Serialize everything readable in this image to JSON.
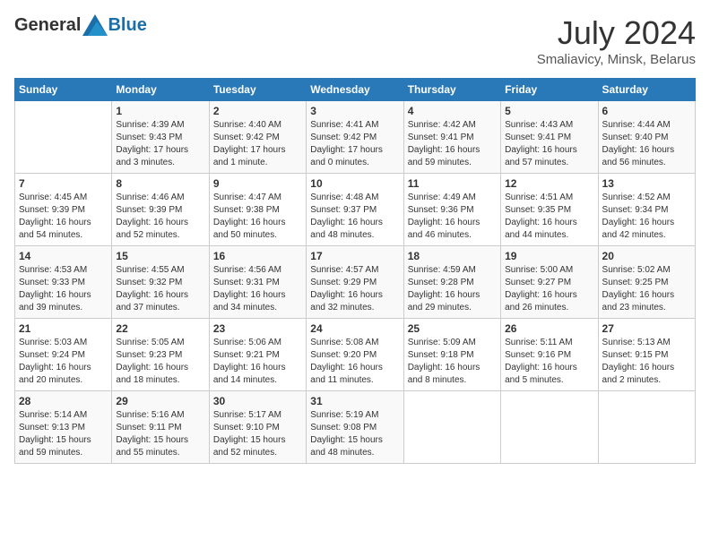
{
  "logo": {
    "general": "General",
    "blue": "Blue"
  },
  "header": {
    "month_year": "July 2024",
    "location": "Smaliavicy, Minsk, Belarus"
  },
  "days_of_week": [
    "Sunday",
    "Monday",
    "Tuesday",
    "Wednesday",
    "Thursday",
    "Friday",
    "Saturday"
  ],
  "weeks": [
    [
      {
        "day": "",
        "info": ""
      },
      {
        "day": "1",
        "info": "Sunrise: 4:39 AM\nSunset: 9:43 PM\nDaylight: 17 hours\nand 3 minutes."
      },
      {
        "day": "2",
        "info": "Sunrise: 4:40 AM\nSunset: 9:42 PM\nDaylight: 17 hours\nand 1 minute."
      },
      {
        "day": "3",
        "info": "Sunrise: 4:41 AM\nSunset: 9:42 PM\nDaylight: 17 hours\nand 0 minutes."
      },
      {
        "day": "4",
        "info": "Sunrise: 4:42 AM\nSunset: 9:41 PM\nDaylight: 16 hours\nand 59 minutes."
      },
      {
        "day": "5",
        "info": "Sunrise: 4:43 AM\nSunset: 9:41 PM\nDaylight: 16 hours\nand 57 minutes."
      },
      {
        "day": "6",
        "info": "Sunrise: 4:44 AM\nSunset: 9:40 PM\nDaylight: 16 hours\nand 56 minutes."
      }
    ],
    [
      {
        "day": "7",
        "info": "Sunrise: 4:45 AM\nSunset: 9:39 PM\nDaylight: 16 hours\nand 54 minutes."
      },
      {
        "day": "8",
        "info": "Sunrise: 4:46 AM\nSunset: 9:39 PM\nDaylight: 16 hours\nand 52 minutes."
      },
      {
        "day": "9",
        "info": "Sunrise: 4:47 AM\nSunset: 9:38 PM\nDaylight: 16 hours\nand 50 minutes."
      },
      {
        "day": "10",
        "info": "Sunrise: 4:48 AM\nSunset: 9:37 PM\nDaylight: 16 hours\nand 48 minutes."
      },
      {
        "day": "11",
        "info": "Sunrise: 4:49 AM\nSunset: 9:36 PM\nDaylight: 16 hours\nand 46 minutes."
      },
      {
        "day": "12",
        "info": "Sunrise: 4:51 AM\nSunset: 9:35 PM\nDaylight: 16 hours\nand 44 minutes."
      },
      {
        "day": "13",
        "info": "Sunrise: 4:52 AM\nSunset: 9:34 PM\nDaylight: 16 hours\nand 42 minutes."
      }
    ],
    [
      {
        "day": "14",
        "info": "Sunrise: 4:53 AM\nSunset: 9:33 PM\nDaylight: 16 hours\nand 39 minutes."
      },
      {
        "day": "15",
        "info": "Sunrise: 4:55 AM\nSunset: 9:32 PM\nDaylight: 16 hours\nand 37 minutes."
      },
      {
        "day": "16",
        "info": "Sunrise: 4:56 AM\nSunset: 9:31 PM\nDaylight: 16 hours\nand 34 minutes."
      },
      {
        "day": "17",
        "info": "Sunrise: 4:57 AM\nSunset: 9:29 PM\nDaylight: 16 hours\nand 32 minutes."
      },
      {
        "day": "18",
        "info": "Sunrise: 4:59 AM\nSunset: 9:28 PM\nDaylight: 16 hours\nand 29 minutes."
      },
      {
        "day": "19",
        "info": "Sunrise: 5:00 AM\nSunset: 9:27 PM\nDaylight: 16 hours\nand 26 minutes."
      },
      {
        "day": "20",
        "info": "Sunrise: 5:02 AM\nSunset: 9:25 PM\nDaylight: 16 hours\nand 23 minutes."
      }
    ],
    [
      {
        "day": "21",
        "info": "Sunrise: 5:03 AM\nSunset: 9:24 PM\nDaylight: 16 hours\nand 20 minutes."
      },
      {
        "day": "22",
        "info": "Sunrise: 5:05 AM\nSunset: 9:23 PM\nDaylight: 16 hours\nand 18 minutes."
      },
      {
        "day": "23",
        "info": "Sunrise: 5:06 AM\nSunset: 9:21 PM\nDaylight: 16 hours\nand 14 minutes."
      },
      {
        "day": "24",
        "info": "Sunrise: 5:08 AM\nSunset: 9:20 PM\nDaylight: 16 hours\nand 11 minutes."
      },
      {
        "day": "25",
        "info": "Sunrise: 5:09 AM\nSunset: 9:18 PM\nDaylight: 16 hours\nand 8 minutes."
      },
      {
        "day": "26",
        "info": "Sunrise: 5:11 AM\nSunset: 9:16 PM\nDaylight: 16 hours\nand 5 minutes."
      },
      {
        "day": "27",
        "info": "Sunrise: 5:13 AM\nSunset: 9:15 PM\nDaylight: 16 hours\nand 2 minutes."
      }
    ],
    [
      {
        "day": "28",
        "info": "Sunrise: 5:14 AM\nSunset: 9:13 PM\nDaylight: 15 hours\nand 59 minutes."
      },
      {
        "day": "29",
        "info": "Sunrise: 5:16 AM\nSunset: 9:11 PM\nDaylight: 15 hours\nand 55 minutes."
      },
      {
        "day": "30",
        "info": "Sunrise: 5:17 AM\nSunset: 9:10 PM\nDaylight: 15 hours\nand 52 minutes."
      },
      {
        "day": "31",
        "info": "Sunrise: 5:19 AM\nSunset: 9:08 PM\nDaylight: 15 hours\nand 48 minutes."
      },
      {
        "day": "",
        "info": ""
      },
      {
        "day": "",
        "info": ""
      },
      {
        "day": "",
        "info": ""
      }
    ]
  ]
}
